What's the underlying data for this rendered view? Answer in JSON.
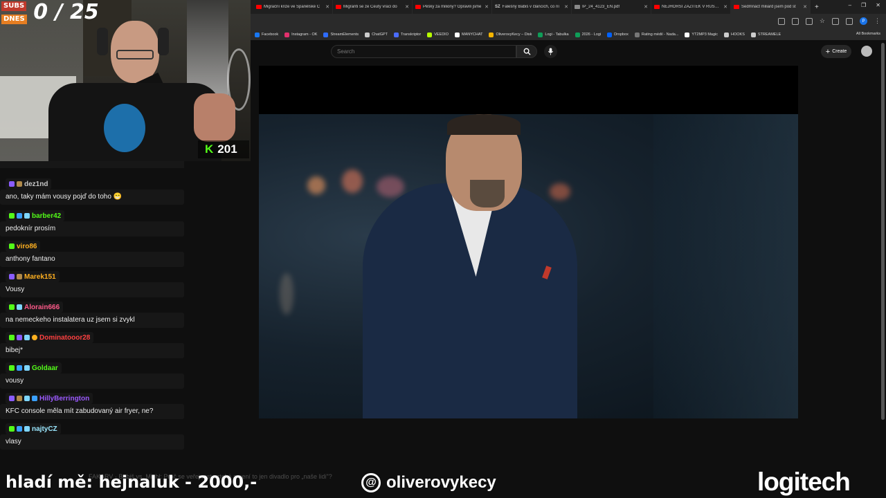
{
  "browser": {
    "tabs": [
      {
        "title": "Migrační krize ve Španělské C",
        "color": "#ff0000"
      },
      {
        "title": "Migranti se ze Ceuty vrací do",
        "color": "#ff0000"
      },
      {
        "title": "Pěšky za miliony? Opravili jsme",
        "color": "#ff0000"
      },
      {
        "title": "Falešný Babiš v článcích, co ní",
        "color": "#ff0000"
      },
      {
        "title": "IP_24_4123_EN.pdf",
        "color": "#888888"
      },
      {
        "title": "NEJHORŠÍ ZÁŽITEK V RUSKU!",
        "color": "#ff0000"
      },
      {
        "title": "Sedmnáct miliard jsem pod st",
        "color": "#ff0000"
      }
    ],
    "tab_fav_prefix": [
      "",
      "",
      "",
      "SZ",
      "",
      "",
      ""
    ],
    "new_tab": "+",
    "window_controls": [
      "–",
      "❐",
      "✕"
    ],
    "bookmarks": [
      {
        "label": "Facebook",
        "color": "#1877f2"
      },
      {
        "label": "Instagram - OK",
        "color": "#e1306c"
      },
      {
        "label": "StreamElements",
        "color": "#2e6cff"
      },
      {
        "label": "ChatGPT",
        "color": "#cccccc"
      },
      {
        "label": "Transkriptor",
        "color": "#4a6cff"
      },
      {
        "label": "VEEDIO",
        "color": "#b6ff00"
      },
      {
        "label": "MANYCHAT",
        "color": "#ffffff"
      },
      {
        "label": "OliverovyKecy – Disk",
        "color": "#f4b400"
      },
      {
        "label": "Logi - Tabulka",
        "color": "#0f9d58"
      },
      {
        "label": "2026 - Logi",
        "color": "#0f9d58"
      },
      {
        "label": "Dropbox",
        "color": "#0061ff"
      },
      {
        "label": "Rating médií - Nada...",
        "color": "#777777"
      },
      {
        "label": "YT2MP3 Magic",
        "color": "#ffffff"
      },
      {
        "label": "HOOKS",
        "color": "#cccccc"
      },
      {
        "label": "STREAMELE",
        "color": "#cccccc"
      }
    ],
    "all_bookmarks": "All Bookmarks",
    "profile_initial": "P"
  },
  "youtube": {
    "search_placeholder": "Search",
    "create_label": "Create"
  },
  "stream": {
    "subs_label_top": "SUBS",
    "subs_label_bottom": "DNES",
    "subs_count": "0 / 25",
    "kick_viewers": "201"
  },
  "chat": {
    "messages": [
      {
        "user": "dez1nd",
        "user_color": "#c7c7c7",
        "text": "ano, taky mám vousy pojď do toho 😁",
        "badges": [
          "#8a5cff",
          "#b08a4a"
        ]
      },
      {
        "user": "barber42",
        "user_color": "#53fc18",
        "text": "pedoknír prosím",
        "badges": [
          "#53fc18",
          "#3aa0ff",
          "#7ed6ff"
        ]
      },
      {
        "user": "viro86",
        "user_color": "#ffb020",
        "text": "anthony fantano",
        "badges": [
          "#53fc18"
        ]
      },
      {
        "user": "Marek151",
        "user_color": "#ffb020",
        "text": "Vousy",
        "badges": [
          "#8a5cff",
          "#b08a4a"
        ]
      },
      {
        "user": "Alorain666",
        "user_color": "#ff5a8a",
        "text": "na nemeckeho instalatera uz jsem si zvykl",
        "badges": [
          "#53fc18",
          "#7ed6ff"
        ]
      },
      {
        "user": "Dominatooor28",
        "user_color": "#ff4040",
        "text": "bibej*",
        "badges": [
          "#53fc18",
          "#8a5cff",
          "#7ed6ff",
          "#ffb020"
        ]
      },
      {
        "user": "Goldaar",
        "user_color": "#53fc18",
        "text": "vousy",
        "badges": [
          "#53fc18",
          "#3aa0ff",
          "#7ed6ff"
        ]
      },
      {
        "user": "HillyBerrington",
        "user_color": "#9b59ff",
        "text": "KFC console měla mít zabudovaný air fryer, ne?",
        "badges": [
          "#8a5cff",
          "#b08a4a",
          "#7ed6ff",
          "#3aa0ff"
        ]
      },
      {
        "user": "najtyCZ",
        "user_color": "#9be8ff",
        "text": "vlasy",
        "badges": [
          "#53fc18",
          "#3aa0ff",
          "#7ed6ff"
        ]
      }
    ]
  },
  "overlay": {
    "bottom_left": "hladí mě: hejnaluk - 2000,-",
    "threads_handle": "oliverovykecy",
    "sponsor": "logitech",
    "ticker": "FAKARV · Babiš vs. Michl: Proč se veřejnost vzteká a není to jen divadlo pro „naše lidi\"?"
  }
}
